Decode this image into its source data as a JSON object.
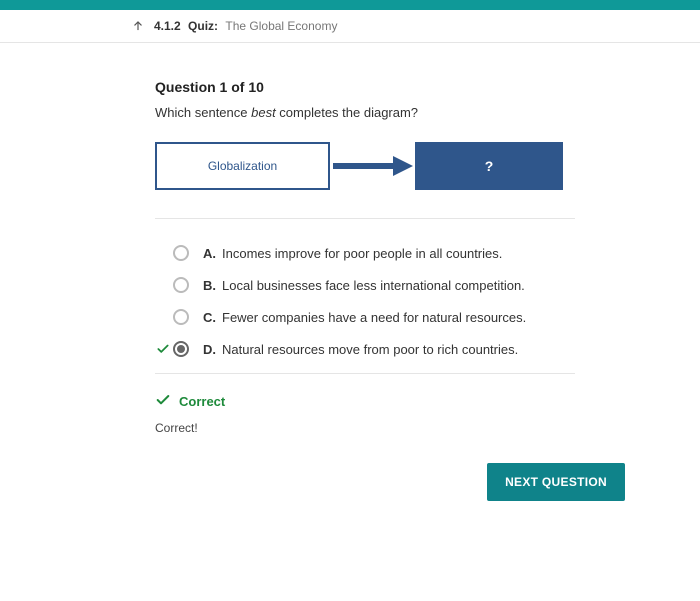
{
  "header": {
    "quiz_code": "4.1.2",
    "quiz_label": "Quiz:",
    "quiz_title": "The Global Economy"
  },
  "question": {
    "number_label": "Question 1 of 10",
    "prompt_pre": "Which sentence ",
    "prompt_em": "best",
    "prompt_post": " completes the diagram?"
  },
  "diagram": {
    "box1": "Globalization",
    "box2": "?"
  },
  "options": [
    {
      "letter": "A.",
      "text": "Incomes improve for poor people in all countries.",
      "selected": false,
      "correct": false
    },
    {
      "letter": "B.",
      "text": "Local businesses face less international competition.",
      "selected": false,
      "correct": false
    },
    {
      "letter": "C.",
      "text": "Fewer companies have a need for natural resources.",
      "selected": false,
      "correct": false
    },
    {
      "letter": "D.",
      "text": "Natural resources move from poor to rich countries.",
      "selected": true,
      "correct": true
    }
  ],
  "feedback": {
    "heading": "Correct",
    "message": "Correct!"
  },
  "next_button": "NEXT QUESTION"
}
